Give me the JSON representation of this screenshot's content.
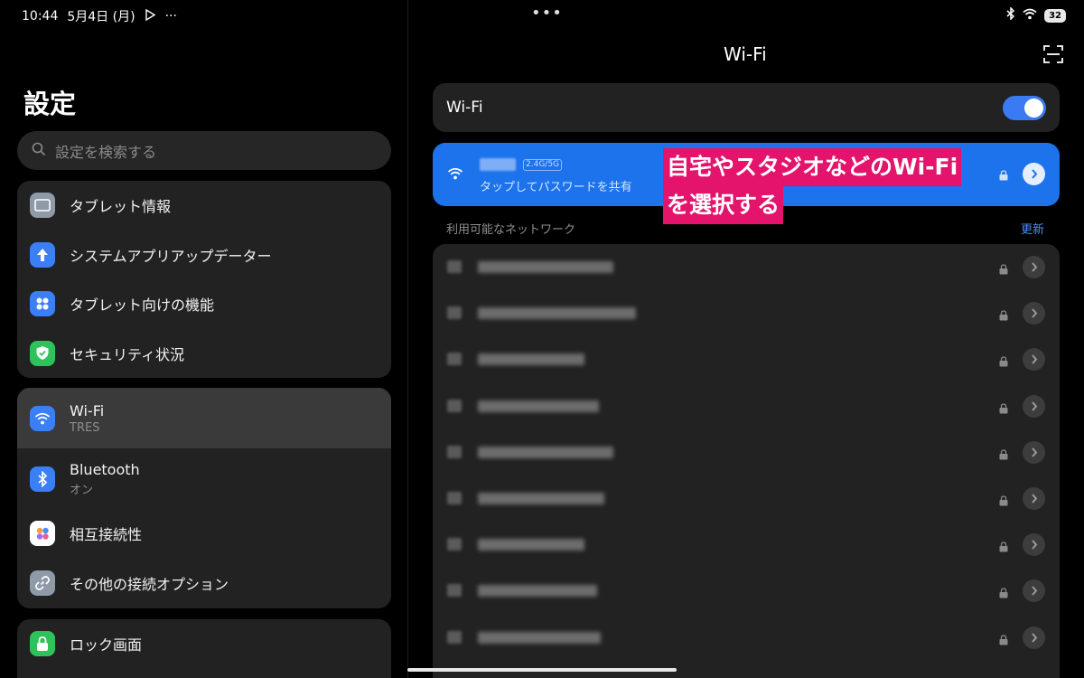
{
  "status_bar": {
    "time": "10:44",
    "date": "5月4日 (月)",
    "more": "···",
    "battery": "32"
  },
  "window_dots": "•••",
  "left": {
    "title": "設定",
    "search_placeholder": "設定を検索する",
    "groups": [
      {
        "items": [
          {
            "label": "タブレット情報",
            "icon": "tablet-icon",
            "color": "#8e9aa8"
          },
          {
            "label": "システムアプリアップデーター",
            "icon": "arrow-up-icon",
            "color": "#3a7ff6"
          },
          {
            "label": "タブレット向けの機能",
            "icon": "grid-dots-icon",
            "color": "#3a7ff6"
          },
          {
            "label": "セキュリティ状況",
            "icon": "shield-check-icon",
            "color": "#2ec25a"
          }
        ]
      },
      {
        "items": [
          {
            "label": "Wi-Fi",
            "sub": "TRES",
            "icon": "wifi-icon",
            "color": "#3a7ff6"
          },
          {
            "label": "Bluetooth",
            "sub": "オン",
            "icon": "bluetooth-icon",
            "color": "#3a7ff6"
          },
          {
            "label": "相互接続性",
            "icon": "interconnect-icon",
            "color": "#ffffff"
          },
          {
            "label": "その他の接続オプション",
            "icon": "link-icon",
            "color": "#8e9aa8"
          }
        ]
      },
      {
        "items": [
          {
            "label": "ロック画面",
            "icon": "lock-icon",
            "color": "#2ec25a"
          }
        ]
      }
    ]
  },
  "right": {
    "title": "Wi-Fi",
    "toggle_label": "Wi-Fi",
    "toggle_on": true,
    "connected": {
      "band": "2.4G/5G",
      "subtitle": "タップしてパスワードを共有"
    },
    "annotation": {
      "line1": "自宅やスタジオなどのWi-Fi",
      "line2": "を選択する"
    },
    "available_header": "利用可能なネットワーク",
    "refresh_label": "更新",
    "networks_count": 9
  },
  "colors": {
    "accent": "#3a7bf4",
    "connected_bg": "#1c73ec",
    "annotation_bg": "#e4136b"
  }
}
